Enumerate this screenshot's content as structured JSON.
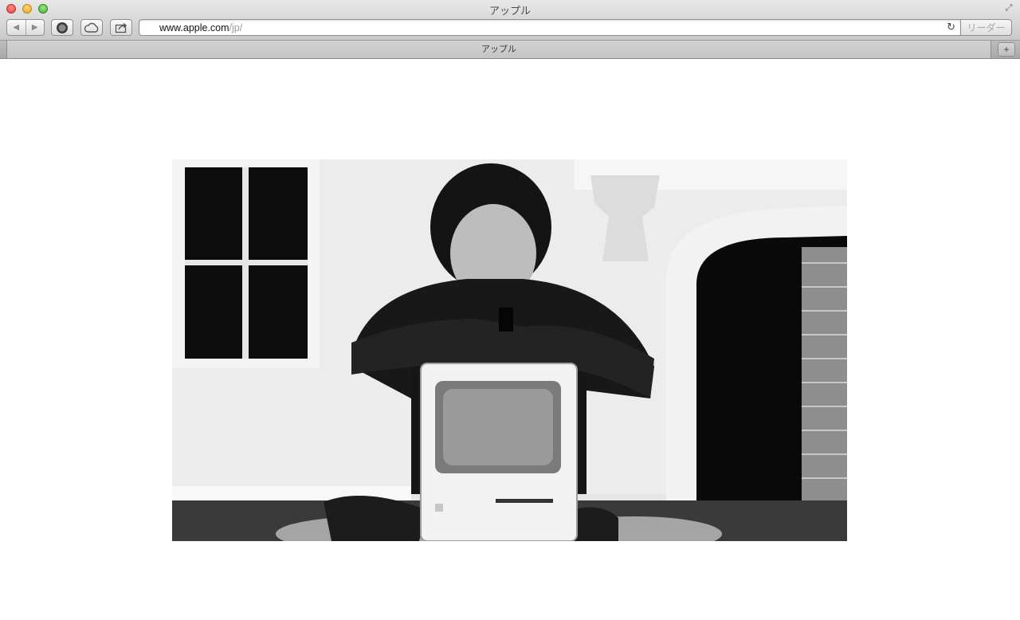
{
  "window": {
    "title": "アップル"
  },
  "toolbar": {
    "back_icon": "back-arrow-icon",
    "forward_icon": "forward-arrow-icon",
    "top_sites_icon": "top-sites-icon",
    "icloud_icon": "icloud-icon",
    "share_icon": "share-icon",
    "reader_label": "リーダー"
  },
  "address": {
    "site_icon": "apple-logo-icon",
    "url_host": "www.apple.com",
    "url_path": "/jp/"
  },
  "tabs": [
    {
      "label": "アップル"
    }
  ],
  "colors": {
    "chrome_top": "#e8e8e8",
    "chrome_bottom": "#c9c9c9",
    "close": "#e0443e",
    "minimize": "#e5a020",
    "zoom": "#3fae2f"
  }
}
